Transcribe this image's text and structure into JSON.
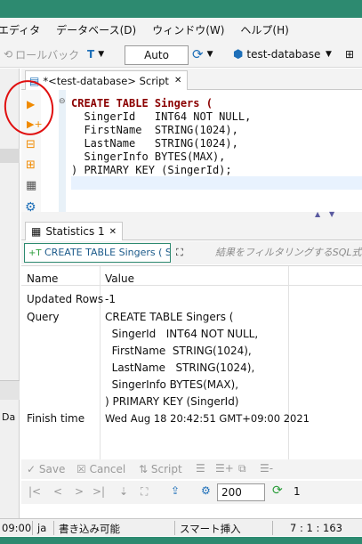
{
  "menu": [
    "エディタ",
    "データベース(D)",
    "ウィンドウ(W)",
    "ヘルプ(H)"
  ],
  "toolbar": {
    "rollback_label": "ロールバック",
    "transaction_mode": "Auto",
    "database": "test-database"
  },
  "editor_tab": {
    "label": "*<test-database> Script",
    "close": "✕"
  },
  "code_lines": [
    "CREATE TABLE Singers (",
    "  SingerId   INT64 NOT NULL,",
    "  FirstName  STRING(1024),",
    "  LastName   STRING(1024),",
    "  SingerInfo BYTES(MAX),",
    ") PRIMARY KEY (SingerId);"
  ],
  "results_tab": {
    "label": "Statistics 1",
    "close": "✕"
  },
  "filter": {
    "query_label": "CREATE TABLE Singers ( Sir",
    "placeholder": "結果をフィルタリングするSQL式を入力し"
  },
  "grid": {
    "columns": [
      "Name",
      "Value"
    ],
    "rows": [
      {
        "name": "Updated Rows",
        "value": [
          "-1"
        ]
      },
      {
        "name": "Query",
        "value": [
          "CREATE TABLE Singers (",
          "  SingerId   INT64 NOT NULL,",
          "  FirstName  STRING(1024),",
          "  LastName   STRING(1024),",
          "  SingerInfo BYTES(MAX),",
          ") PRIMARY KEY (SingerId)"
        ]
      },
      {
        "name": "Finish time",
        "value": [
          "Wed Aug 18 20:42:51 GMT+09:00 2021"
        ]
      }
    ]
  },
  "results_toolbar": {
    "save": "Save",
    "cancel": "Cancel",
    "script": "Script"
  },
  "nav": {
    "fetch_size": "200",
    "row_count": "1"
  },
  "status": {
    "time": "09:00",
    "locale": "ja",
    "write_mode": "書き込み可能",
    "insert_mode": "スマート挿入",
    "position": "7 : 1 : 163"
  },
  "colors": {
    "accent": "#2d8a70",
    "keyword": "#8b0000",
    "annotation": "#e01010"
  }
}
